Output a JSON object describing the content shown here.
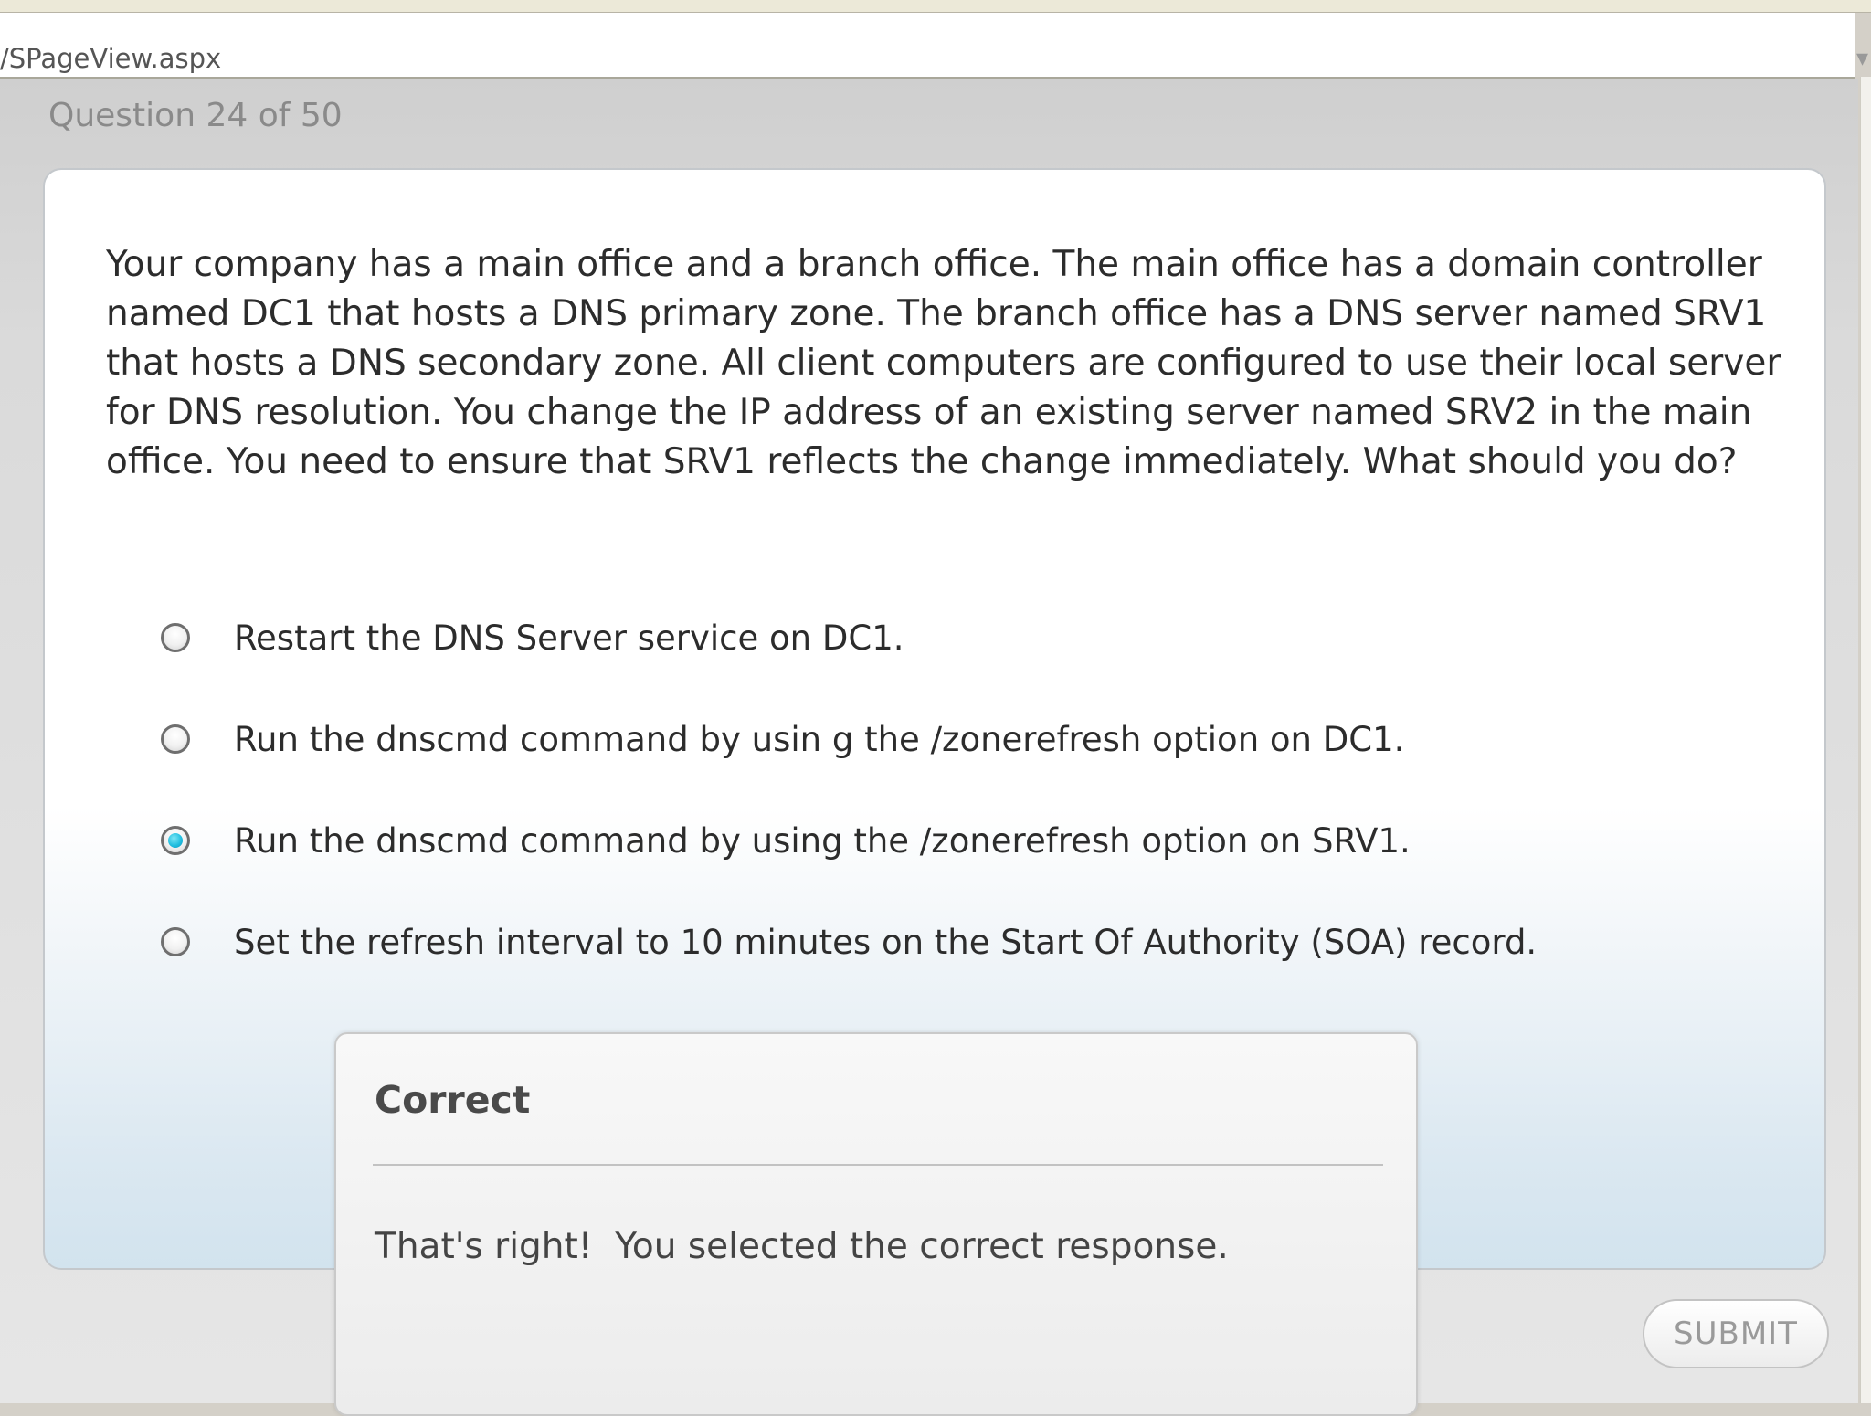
{
  "browser": {
    "address": "/SPageView.aspx"
  },
  "header": {
    "counter": "Question 24 of 50"
  },
  "question": {
    "text": "Your company has a main office and a branch office. The main office has a domain controller named DC1 that hosts a DNS primary zone. The branch office has a DNS server named SRV1 that hosts a DNS secondary zone. All client computers are configured to use their local server for DNS resolution. You change the IP address of an existing server named SRV2 in the main office. You need to ensure that SRV1 reflects the change immediately. What should you do?"
  },
  "options": [
    {
      "label": "Restart the DNS Server service on DC1.",
      "selected": false
    },
    {
      "label": "Run the dnscmd command by usin g the /zonerefresh option on DC1.",
      "selected": false
    },
    {
      "label": "Run the dnscmd command by using the /zonerefresh option on SRV1.",
      "selected": true
    },
    {
      "label": "Set the refresh interval to 10 minutes on the Start Of Authority (SOA) record.",
      "selected": false
    }
  ],
  "feedback": {
    "title": "Correct",
    "message": "That's right!  You selected the correct response."
  },
  "actions": {
    "submit_label": "SUBMIT"
  },
  "colors": {
    "selected_radio": "#22bfe0",
    "card_gradient_bottom": "#d2e3ee"
  }
}
